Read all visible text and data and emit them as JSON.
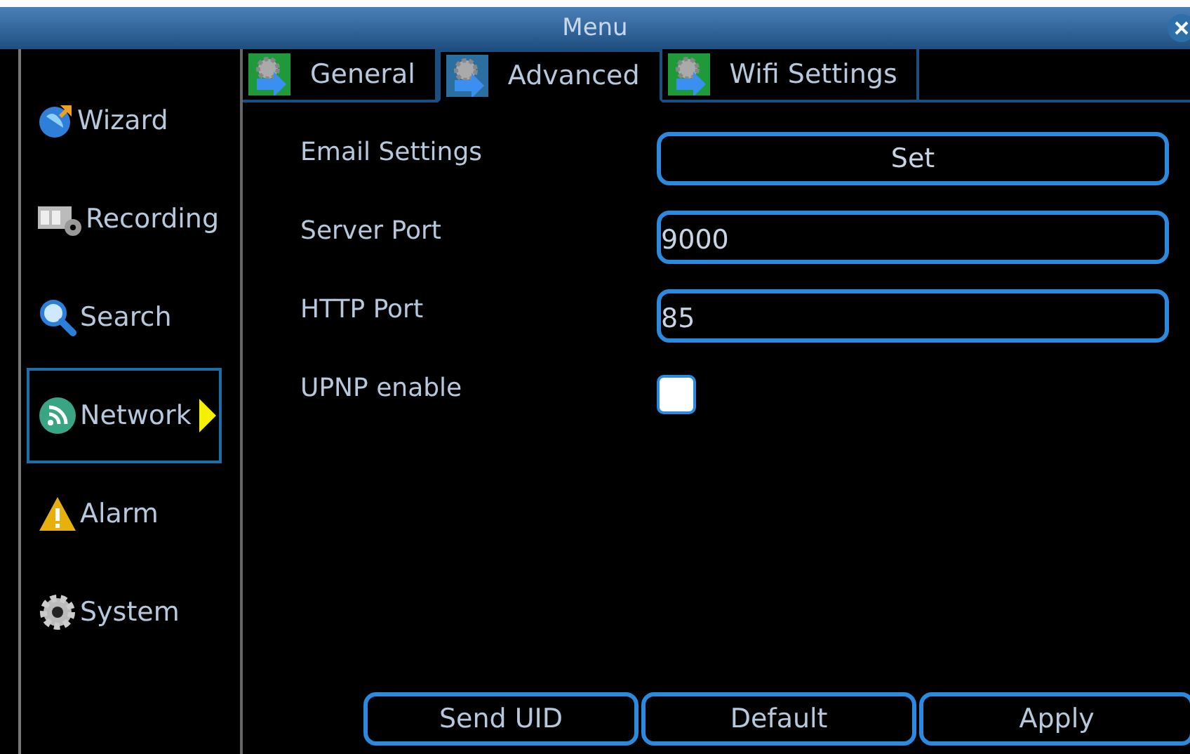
{
  "window": {
    "title": "Menu"
  },
  "sidebar": {
    "items": [
      {
        "label": "Wizard",
        "selected": false
      },
      {
        "label": "Recording",
        "selected": false
      },
      {
        "label": "Search",
        "selected": false
      },
      {
        "label": "Network",
        "selected": true
      },
      {
        "label": "Alarm",
        "selected": false
      },
      {
        "label": "System",
        "selected": false
      }
    ]
  },
  "tabs": [
    {
      "label": "General",
      "selected": false
    },
    {
      "label": "Advanced",
      "selected": true
    },
    {
      "label": "Wifi Settings",
      "selected": false
    }
  ],
  "form": [
    {
      "kind": "button",
      "label": "Email Settings",
      "value": "Set"
    },
    {
      "kind": "text",
      "label": "Server Port",
      "value": "9000"
    },
    {
      "kind": "text",
      "label": "HTTP Port",
      "value": "85"
    },
    {
      "kind": "checkbox",
      "label": "UPNP enable",
      "checked": false
    }
  ],
  "buttons": [
    "Send UID",
    "Default",
    "Apply"
  ]
}
